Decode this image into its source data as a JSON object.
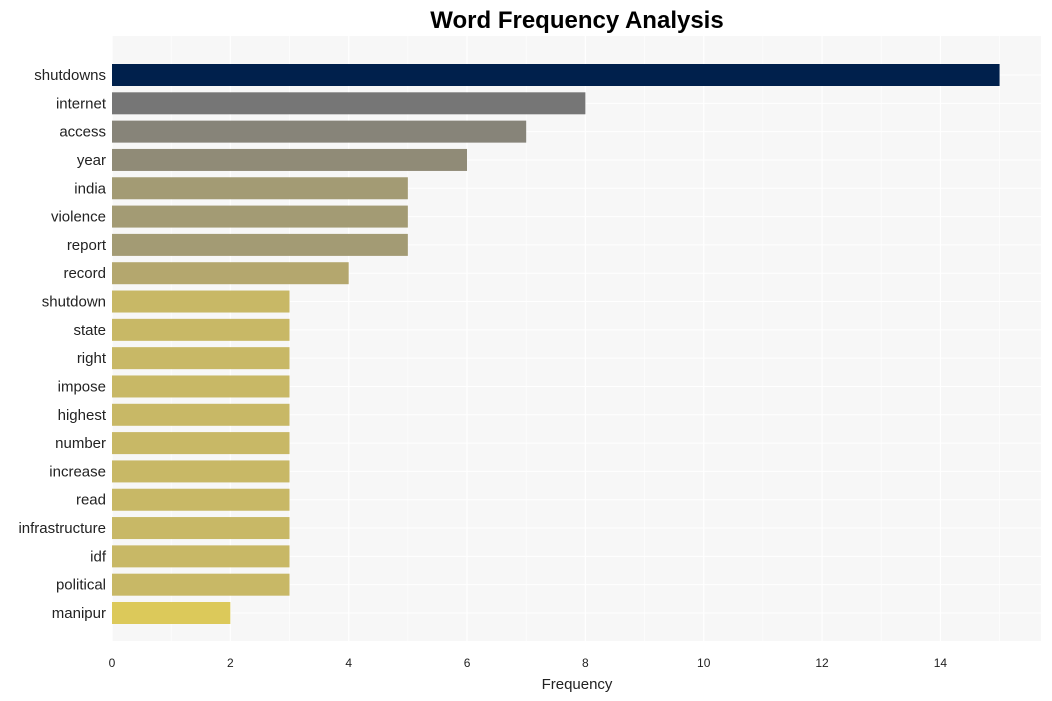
{
  "chart_data": {
    "type": "bar",
    "orientation": "horizontal",
    "title": "Word Frequency Analysis",
    "xlabel": "Frequency",
    "ylabel": "",
    "xlim": [
      0,
      15.7
    ],
    "xticks": [
      0,
      2,
      4,
      6,
      8,
      10,
      12,
      14
    ],
    "grid": true,
    "legend": "none",
    "categories": [
      "shutdowns",
      "internet",
      "access",
      "year",
      "india",
      "violence",
      "report",
      "record",
      "shutdown",
      "state",
      "right",
      "impose",
      "highest",
      "number",
      "increase",
      "read",
      "infrastructure",
      "idf",
      "political",
      "manipur"
    ],
    "values": [
      15,
      8,
      7,
      6,
      5,
      5,
      5,
      4,
      3,
      3,
      3,
      3,
      3,
      3,
      3,
      3,
      3,
      3,
      3,
      2
    ],
    "colors": [
      "#00204c",
      "#767676",
      "#878479",
      "#908b77",
      "#a39b74",
      "#a39b74",
      "#a39b74",
      "#b4a76e",
      "#c8b866",
      "#c8b866",
      "#c8b866",
      "#c8b866",
      "#c8b866",
      "#c8b866",
      "#c8b866",
      "#c8b866",
      "#c8b866",
      "#c8b866",
      "#c8b866",
      "#dcc95a"
    ]
  },
  "colors": {
    "plot_background": "#f7f7f7",
    "grid": "#ffffff"
  }
}
